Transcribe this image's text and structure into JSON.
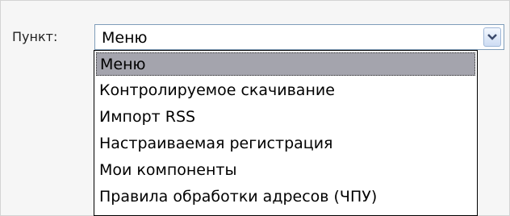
{
  "field": {
    "label": "Пункт:",
    "selected_value": "Меню"
  },
  "icons": {
    "dropdown_arrow": "chevron-down-icon"
  },
  "dropdown": {
    "options": [
      "Меню",
      "Контролируемое скачивание",
      "Импорт RSS",
      "Настраиваемая регистрация",
      "Мои компоненты",
      "Правила обработки адресов (ЧПУ)"
    ],
    "highlighted_index": 0
  },
  "colors": {
    "highlight": "#a4a4ad",
    "select_border": "#7f9db9"
  }
}
